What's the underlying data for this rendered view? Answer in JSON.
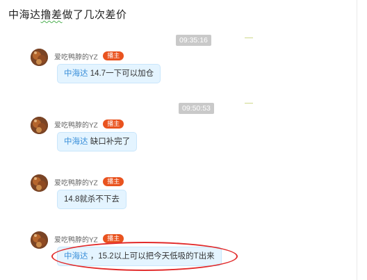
{
  "header": {
    "title_before": "中海达",
    "title_underlined": "撸差",
    "title_after": "做了几次差价"
  },
  "timestamps": [
    "09:35:16",
    "09:50:53"
  ],
  "messages": [
    {
      "nickname": "爱吃鸭脖的YZ",
      "badge": "播主",
      "mention": "中海达",
      "text": " 14.7一下可以加仓"
    },
    {
      "nickname": "爱吃鸭脖的YZ",
      "badge": "播主",
      "mention": "中海达",
      "text": " 缺口补完了"
    },
    {
      "nickname": "爱吃鸭脖的YZ",
      "badge": "播主",
      "mention": "",
      "text": "14.8就杀不下去"
    },
    {
      "nickname": "爱吃鸭脖的YZ",
      "badge": "播主",
      "mention": "中海达",
      "text": " ，15.2以上可以把今天低吸的T出来"
    }
  ],
  "colors": {
    "badge": "#e9531f",
    "bubble": "#e4f4ff",
    "mention": "#3a8fd9",
    "highlight_ring": "#e22b2b"
  }
}
